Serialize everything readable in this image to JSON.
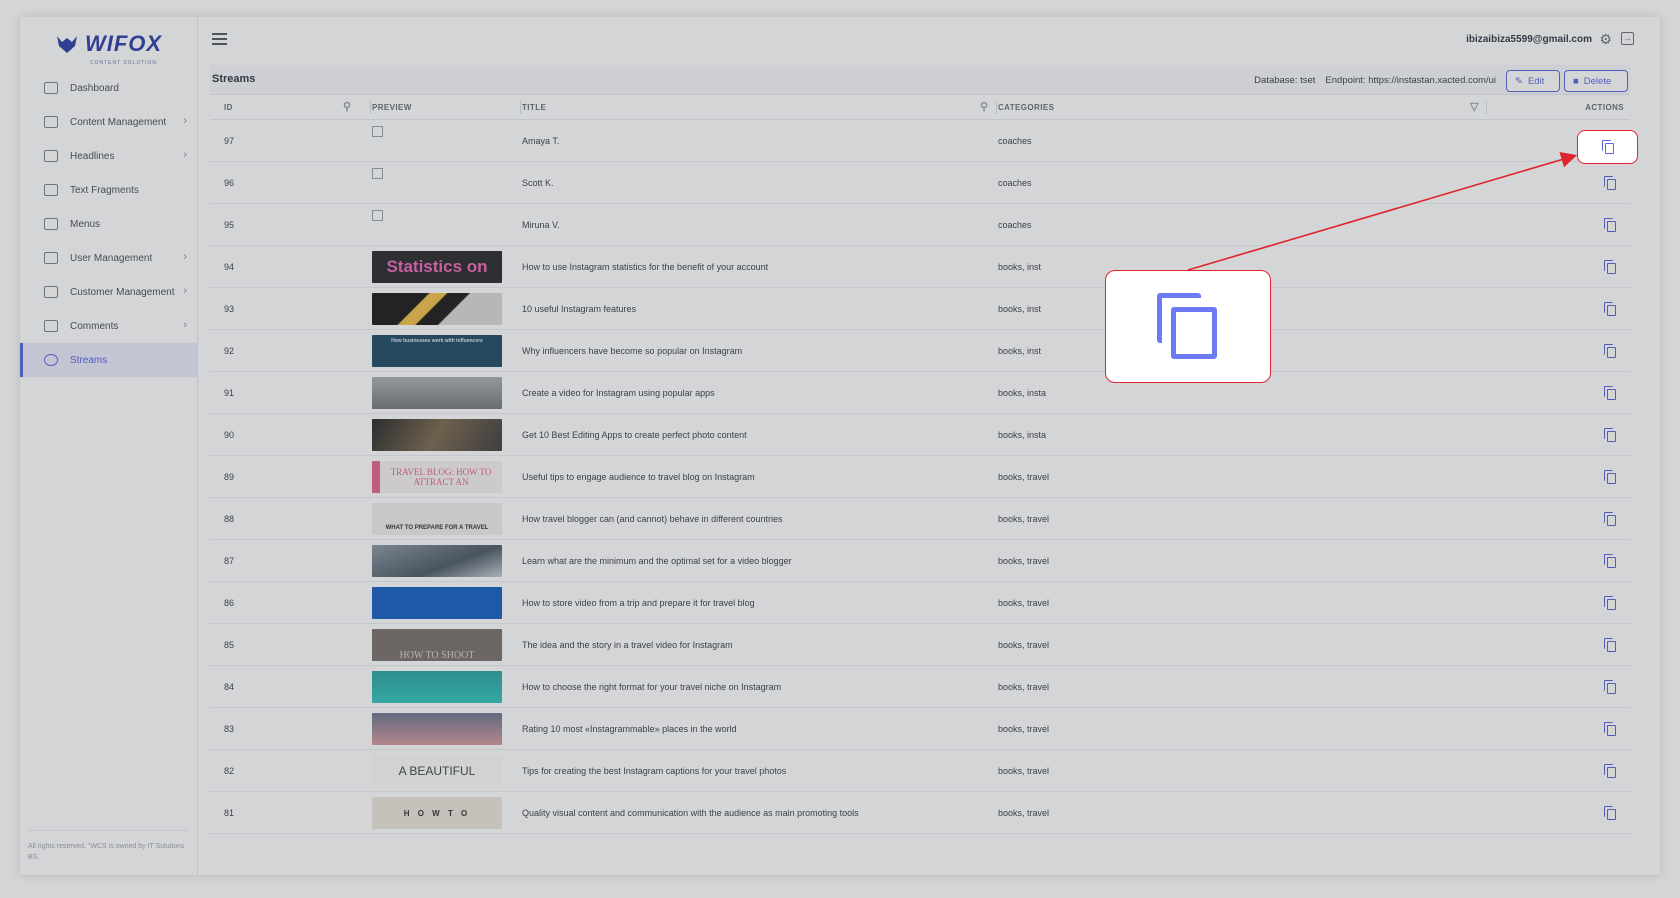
{
  "app": {
    "logo_text": "WIFOX",
    "logo_sub": "CONTENT SOLUTION"
  },
  "sidebar": {
    "items": [
      {
        "label": "Dashboard",
        "chev": ""
      },
      {
        "label": "Content Management",
        "chev": "›"
      },
      {
        "label": "Headlines",
        "chev": "›"
      },
      {
        "label": "Text Fragments",
        "chev": ""
      },
      {
        "label": "Menus",
        "chev": ""
      },
      {
        "label": "User Management",
        "chev": "›"
      },
      {
        "label": "Customer Management",
        "chev": "›"
      },
      {
        "label": "Comments",
        "chev": "›"
      },
      {
        "label": "Streams",
        "chev": ""
      }
    ],
    "footer": "All rights reserved. \"WCS is owned by IT Solutions BS."
  },
  "topbar": {
    "email": "ibizaibiza5599@gmail.com"
  },
  "page": {
    "title": "Streams",
    "database": "Database: tset",
    "endpoint": "Endpoint: https://instastan.xacted.com/ui",
    "edit_label": "Edit",
    "delete_label": "Delete"
  },
  "table": {
    "headers": {
      "id": "ID",
      "preview": "PREVIEW",
      "title": "TITLE",
      "categories": "CATEGORIES",
      "actions": "ACTIONS"
    },
    "rows": [
      {
        "id": "97",
        "title": "Amaya T.",
        "categories": "coaches",
        "thumb_text": ""
      },
      {
        "id": "96",
        "title": "Scott K.",
        "categories": "coaches",
        "thumb_text": ""
      },
      {
        "id": "95",
        "title": "Miruna V.",
        "categories": "coaches",
        "thumb_text": ""
      },
      {
        "id": "94",
        "title": "How to use Instagram statistics for the benefit of your account",
        "categories": "books, inst",
        "thumb_text": "Statistics on"
      },
      {
        "id": "93",
        "title": "10 useful Instagram features",
        "categories": "books, inst",
        "thumb_text": ""
      },
      {
        "id": "92",
        "title": "Why influencers have become so popular on Instagram",
        "categories": "books, inst",
        "thumb_text": "How businesses work with influencers"
      },
      {
        "id": "91",
        "title": "Create a video for Instagram using popular apps",
        "categories": "books, insta",
        "thumb_text": ""
      },
      {
        "id": "90",
        "title": "Get 10 Best Editing Apps to create perfect photo content",
        "categories": "books, insta",
        "thumb_text": ""
      },
      {
        "id": "89",
        "title": "Useful tips to engage audience to travel blog on Instagram",
        "categories": "books, travel",
        "thumb_text": "TRAVEL BLOG: HOW TO ATTRACT AN"
      },
      {
        "id": "88",
        "title": "How travel blogger can (and cannot) behave in different countries",
        "categories": "books, travel",
        "thumb_text": "WHAT TO PREPARE FOR A TRAVEL"
      },
      {
        "id": "87",
        "title": "Learn what are the minimum and the optimal set for a video blogger",
        "categories": "books, travel",
        "thumb_text": ""
      },
      {
        "id": "86",
        "title": "How to store video from a trip and prepare it for travel blog",
        "categories": "books, travel",
        "thumb_text": ""
      },
      {
        "id": "85",
        "title": "The idea and the story in a travel video for Instagram",
        "categories": "books, travel",
        "thumb_text": "HOW TO SHOOT"
      },
      {
        "id": "84",
        "title": "How to choose the right format for your travel niche on Instagram",
        "categories": "books, travel",
        "thumb_text": ""
      },
      {
        "id": "83",
        "title": "Rating 10 most «Instagrammable» places in the world",
        "categories": "books, travel",
        "thumb_text": ""
      },
      {
        "id": "82",
        "title": "Tips for creating the best Instagram captions for your travel photos",
        "categories": "books, travel",
        "thumb_text": "A BEAUTIFUL"
      },
      {
        "id": "81",
        "title": "Quality visual content and communication with the audience as main promoting tools",
        "categories": "books, travel",
        "thumb_text": "H O W  T O"
      }
    ]
  },
  "colors": {
    "accent": "#5a67d8",
    "highlight": "#e0242c"
  }
}
